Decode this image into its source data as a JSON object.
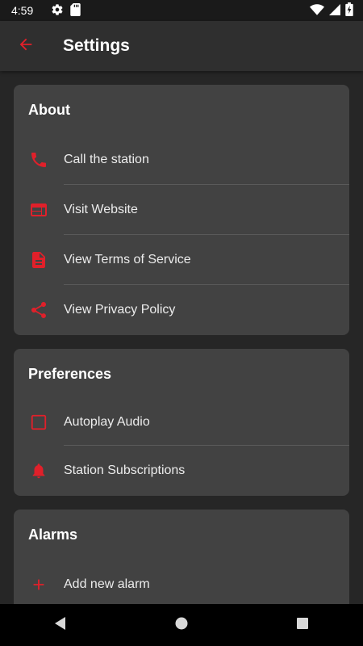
{
  "status_bar": {
    "time": "4:59",
    "icons": [
      "gear-icon",
      "sd-card-icon",
      "wifi-icon",
      "signal-icon",
      "battery-charging-icon"
    ]
  },
  "app_bar": {
    "title": "Settings",
    "back_icon": "arrow-back-icon"
  },
  "colors": {
    "accent": "#e0202a",
    "background": "#262626",
    "card": "#424242",
    "app_bar": "#2f2f2f"
  },
  "sections": {
    "about": {
      "title": "About",
      "items": [
        {
          "label": "Call the station",
          "icon": "phone-icon"
        },
        {
          "label": "Visit Website",
          "icon": "web-icon"
        },
        {
          "label": "View Terms of Service",
          "icon": "document-icon"
        },
        {
          "label": "View Privacy Policy",
          "icon": "share-icon"
        }
      ]
    },
    "preferences": {
      "title": "Preferences",
      "items": [
        {
          "label": "Autoplay Audio",
          "icon": "checkbox-icon",
          "checked": false
        },
        {
          "label": "Station Subscriptions",
          "icon": "bell-icon"
        }
      ]
    },
    "alarms": {
      "title": "Alarms",
      "items": [
        {
          "label": "Add new alarm",
          "icon": "plus-icon"
        }
      ]
    }
  },
  "nav_bar": {
    "buttons": [
      "back-triangle-icon",
      "home-circle-icon",
      "recents-square-icon"
    ]
  }
}
